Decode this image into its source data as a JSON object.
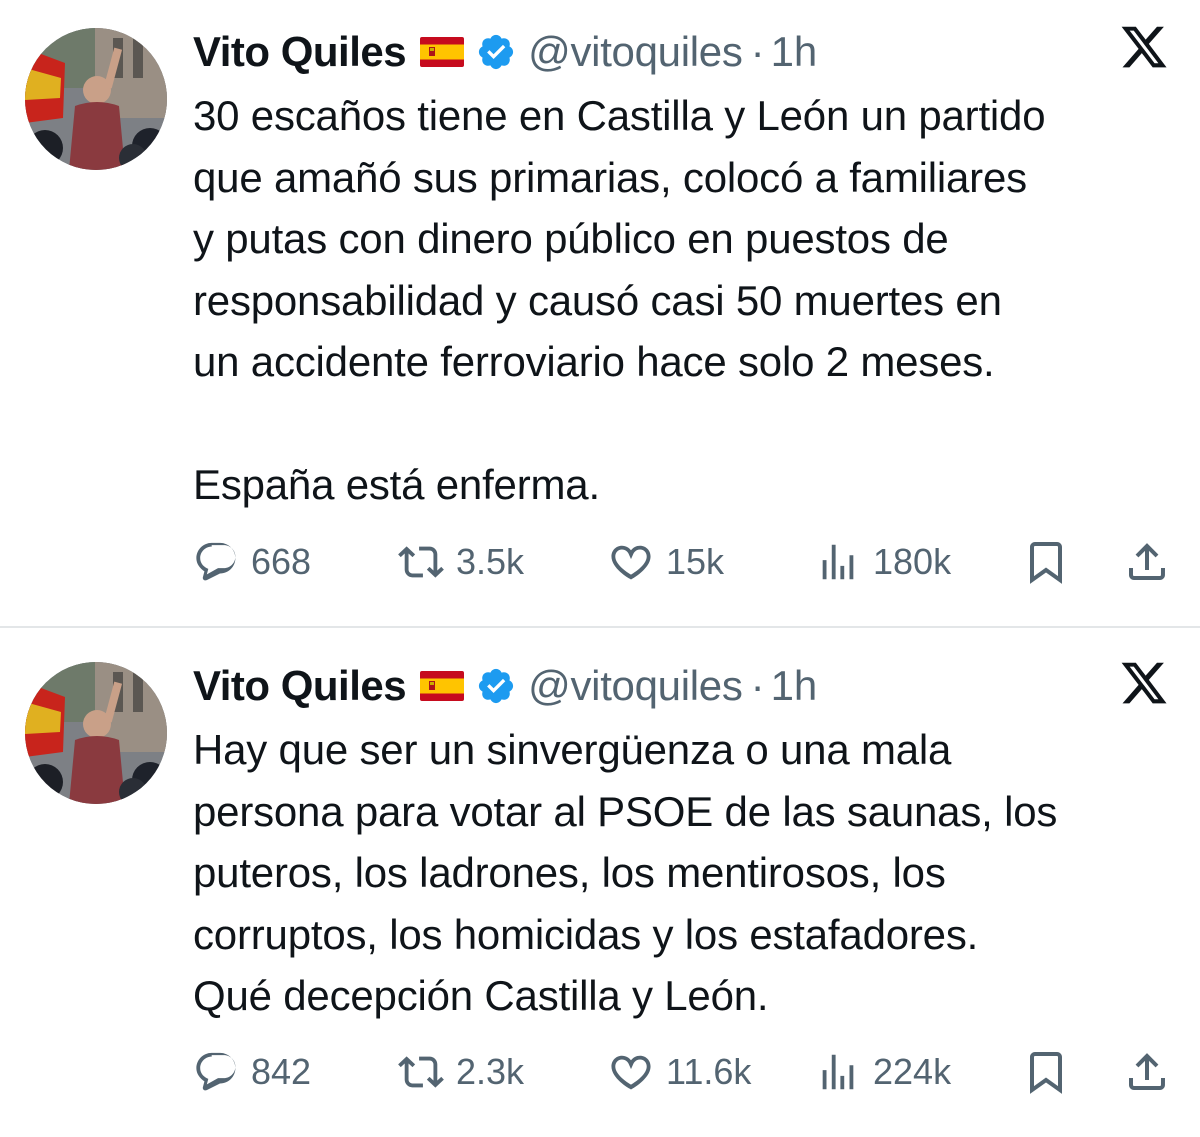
{
  "tweets": [
    {
      "display_name": "Vito Quiles",
      "flag_icon": "spain-flag-emoji",
      "verified_icon": "verified-badge-icon",
      "handle": "@vitoquiles",
      "separator": "·",
      "time": "1h",
      "text": "30 escaños tiene en Castilla y León un partido\nque amañó sus primarias, colocó a familiares\ny putas con dinero público en puestos de\nresponsabilidad y causó casi 50 muertes en\nun accidente ferroviario hace solo 2 meses.\n\nEspaña está enferma.",
      "replies": "668",
      "reposts": "3.5k",
      "likes": "15k",
      "views": "180k"
    },
    {
      "display_name": "Vito Quiles",
      "flag_icon": "spain-flag-emoji",
      "verified_icon": "verified-badge-icon",
      "handle": "@vitoquiles",
      "separator": "·",
      "time": "1h",
      "text": "Hay que ser un sinvergüenza o una mala\npersona para votar al PSOE de las saunas, los\nputeros, los ladrones, los mentirosos, los\ncorruptos, los homicidas y los estafadores.\nQué decepción Castilla y León.",
      "replies": "842",
      "reposts": "2.3k",
      "likes": "11.6k",
      "views": "224k"
    }
  ],
  "colors": {
    "text": "#0f1419",
    "secondary": "#536471",
    "verified": "#1d9bf0",
    "divider": "#e3e6e8",
    "flag_red": "#c60b1e",
    "flag_yellow": "#ffc400"
  },
  "icons": {
    "platform": "x-logo-icon",
    "reply": "reply-icon",
    "repost": "repost-icon",
    "like": "heart-icon",
    "views": "views-chart-icon",
    "bookmark": "bookmark-icon",
    "share": "share-icon"
  }
}
